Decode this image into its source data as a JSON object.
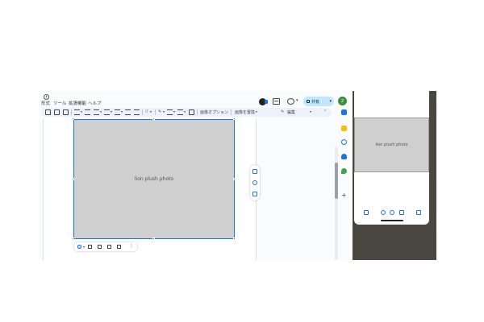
{
  "menubar": {
    "items": [
      "形式",
      "ツール",
      "拡張機能",
      "ヘルプ"
    ]
  },
  "header": {
    "share_label": "共有",
    "avatar_initial": "2"
  },
  "toolbar": {
    "image_options_label": "画像オプション",
    "replace_image_label": "画像を置換",
    "edit_mode_label": "編集"
  },
  "document": {
    "image_alt": "lion plush photo"
  },
  "phone": {
    "image_alt": "lion plush photo"
  },
  "colors": {
    "accent": "#1a73e8",
    "share_bg": "#c2e7ff",
    "toolbar_bg": "#edf2fa",
    "avatar_bg": "#3d8f3d"
  }
}
